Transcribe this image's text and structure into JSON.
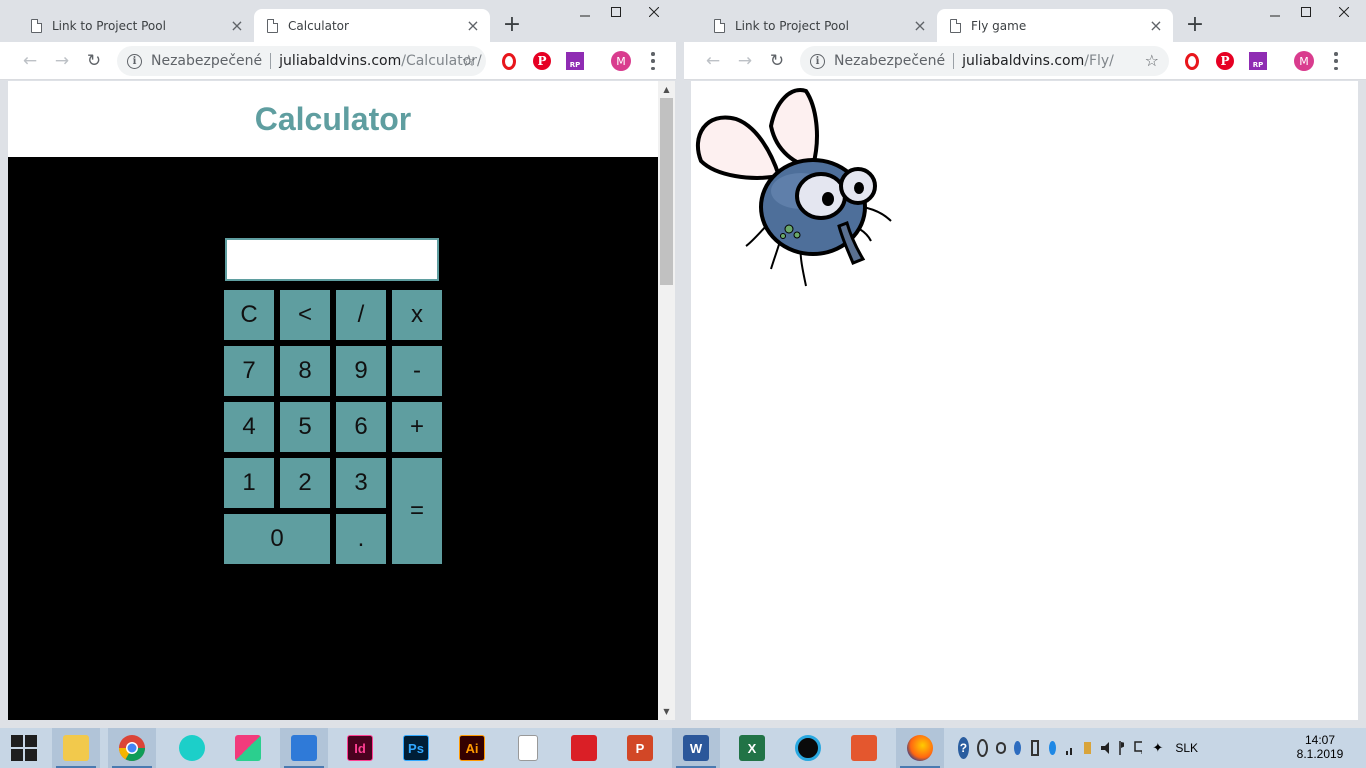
{
  "left_window": {
    "tabs": [
      {
        "title": "Link to Project Pool",
        "close": "×"
      },
      {
        "title": "Calculator",
        "close": "×"
      }
    ],
    "new_tab": "+",
    "address": {
      "security": "Nezabezpečené",
      "host": "juliabaldvins.com",
      "path": "/Calculator/"
    },
    "page": {
      "heading": "Calculator",
      "display_value": "",
      "keys": {
        "clear": "C",
        "back": "<",
        "divide": "/",
        "multiply": "x",
        "seven": "7",
        "eight": "8",
        "nine": "9",
        "minus": "-",
        "four": "4",
        "five": "5",
        "six": "6",
        "plus": "+",
        "one": "1",
        "two": "2",
        "three": "3",
        "equals": "=",
        "zero": "0",
        "dot": "."
      }
    }
  },
  "right_window": {
    "tabs": [
      {
        "title": "Link to Project Pool",
        "close": "×"
      },
      {
        "title": "Fly game",
        "close": "×"
      }
    ],
    "new_tab": "+",
    "address": {
      "security": "Nezabezpečené",
      "host": "juliabaldvins.com",
      "path": "/Fly/"
    }
  },
  "extensions": {
    "pinterest": "P",
    "rp": "RP",
    "profile": "M"
  },
  "taskbar": {
    "apps": [
      "file-explorer",
      "chrome",
      "teal-circle",
      "pink-app",
      "vscode",
      "indesign",
      "photoshop",
      "illustrator",
      "notepad",
      "creative-cloud",
      "powerpoint",
      "word",
      "excel",
      "circular-app",
      "orange-app",
      "firefox"
    ],
    "labels": {
      "indesign": "Id",
      "photoshop": "Ps",
      "illustrator": "Ai",
      "word": "W",
      "excel": "X",
      "powerpoint": "P"
    },
    "language": "SLK",
    "time": "14:07",
    "date": "8.1.2019"
  },
  "colors": {
    "calc_accent": "#5f9ea0",
    "calc_bg": "#000000",
    "chrome_frame": "#dee1e6"
  }
}
